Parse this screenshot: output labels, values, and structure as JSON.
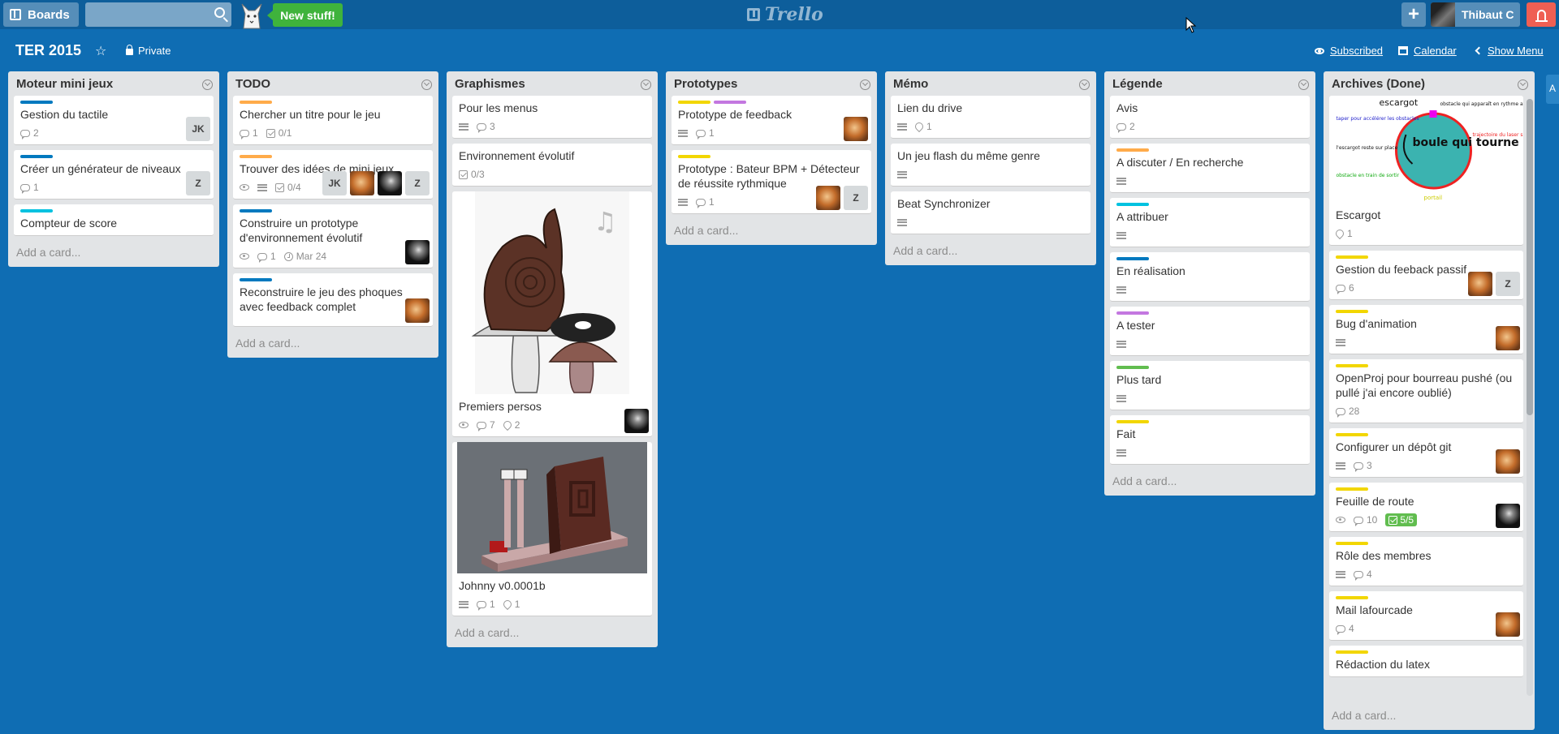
{
  "header": {
    "boards_label": "Boards",
    "search_placeholder": "",
    "new_stuff_label": "New stuff!",
    "logo_text": "Trello",
    "plus_label": "+",
    "user_name": "Thibaut C"
  },
  "board": {
    "title": "TER 2015",
    "privacy": "Private",
    "subscribed_label": "Subscribed",
    "calendar_label": "Calendar",
    "show_menu_label": "Show Menu",
    "side_tab": "A"
  },
  "colors": {
    "board_bg": "#0f6db3",
    "green": "#61bd4f",
    "yellow": "#f2d600",
    "orange": "#ffab4a",
    "purple": "#c377e0",
    "blue": "#0079bf",
    "sky": "#00c2e0",
    "lime": "#51e898"
  },
  "add_card_label": "Add a card...",
  "lists": [
    {
      "title": "Moteur mini jeux",
      "cards": [
        {
          "labels": [
            "blue"
          ],
          "title": "Gestion du tactile",
          "badges": [
            {
              "icon": "comment",
              "text": "2"
            }
          ],
          "members": [
            {
              "initials": "JK"
            }
          ]
        },
        {
          "labels": [
            "blue"
          ],
          "title": "Créer un générateur de niveaux",
          "badges": [
            {
              "icon": "comment",
              "text": "1"
            }
          ],
          "members": [
            {
              "initials": "Z"
            }
          ]
        },
        {
          "labels": [
            "sky"
          ],
          "title": "Compteur de score",
          "badges": [],
          "members": []
        }
      ]
    },
    {
      "title": "TODO",
      "cards": [
        {
          "labels": [
            "orange"
          ],
          "title": "Chercher un titre pour le jeu",
          "badges": [
            {
              "icon": "comment",
              "text": "1"
            },
            {
              "icon": "check",
              "text": "0/1"
            }
          ],
          "members": []
        },
        {
          "labels": [
            "orange"
          ],
          "title": "Trouver des idées de mini jeux",
          "badges": [
            {
              "icon": "eye",
              "text": ""
            },
            {
              "icon": "desc",
              "text": ""
            },
            {
              "icon": "check",
              "text": "0/4"
            }
          ],
          "members": [
            {
              "initials": "JK"
            },
            {
              "initials": "",
              "style": "fox"
            },
            {
              "initials": "",
              "style": "dark"
            },
            {
              "initials": "Z"
            }
          ]
        },
        {
          "labels": [
            "blue"
          ],
          "title": "Construire un prototype d'environnement évolutif",
          "badges": [
            {
              "icon": "eye",
              "text": ""
            },
            {
              "icon": "comment",
              "text": "1"
            },
            {
              "icon": "clock",
              "text": "Mar 24"
            }
          ],
          "members": [
            {
              "initials": "",
              "style": "dark"
            }
          ]
        },
        {
          "labels": [
            "blue"
          ],
          "title": "Reconstruire le jeu des phoques avec feedback complet",
          "badges": [],
          "members": [
            {
              "initials": "",
              "style": "fox"
            }
          ]
        }
      ]
    },
    {
      "title": "Graphismes",
      "cards": [
        {
          "labels": [],
          "title": "Pour les menus",
          "badges": [
            {
              "icon": "desc",
              "text": ""
            },
            {
              "icon": "comment",
              "text": "3"
            }
          ],
          "members": []
        },
        {
          "labels": [],
          "title": "Environnement évolutif",
          "badges": [
            {
              "icon": "check",
              "text": "0/3"
            }
          ],
          "members": []
        },
        {
          "labels": [],
          "cover": "snail",
          "title": "Premiers persos",
          "badges": [
            {
              "icon": "eye",
              "text": ""
            },
            {
              "icon": "comment",
              "text": "7"
            },
            {
              "icon": "attach",
              "text": "2"
            }
          ],
          "members": [
            {
              "initials": "",
              "style": "dark"
            }
          ]
        },
        {
          "labels": [],
          "cover": "render",
          "title": "Johnny v0.0001b",
          "badges": [
            {
              "icon": "desc",
              "text": ""
            },
            {
              "icon": "comment",
              "text": "1"
            },
            {
              "icon": "attach",
              "text": "1"
            }
          ],
          "members": []
        }
      ]
    },
    {
      "title": "Prototypes",
      "cards": [
        {
          "labels": [
            "yellow",
            "purple"
          ],
          "title": "Prototype de feedback",
          "badges": [
            {
              "icon": "desc",
              "text": ""
            },
            {
              "icon": "comment",
              "text": "1"
            }
          ],
          "members": [
            {
              "initials": "",
              "style": "fox"
            }
          ]
        },
        {
          "labels": [
            "yellow"
          ],
          "title": "Prototype : Bateur BPM + Détecteur de réussite rythmique",
          "badges": [
            {
              "icon": "desc",
              "text": ""
            },
            {
              "icon": "comment",
              "text": "1"
            }
          ],
          "members": [
            {
              "initials": "",
              "style": "fox"
            },
            {
              "initials": "Z"
            }
          ]
        }
      ]
    },
    {
      "title": "Mémo",
      "cards": [
        {
          "labels": [],
          "title": "Lien du drive",
          "badges": [
            {
              "icon": "desc",
              "text": ""
            },
            {
              "icon": "attach",
              "text": "1"
            }
          ],
          "members": []
        },
        {
          "labels": [],
          "title": "Un jeu flash du même genre",
          "badges": [
            {
              "icon": "desc",
              "text": ""
            }
          ],
          "members": []
        },
        {
          "labels": [],
          "title": "Beat Synchronizer",
          "badges": [
            {
              "icon": "desc",
              "text": ""
            }
          ],
          "members": []
        }
      ]
    },
    {
      "title": "Légende",
      "cards": [
        {
          "labels": [],
          "title": "Avis",
          "badges": [
            {
              "icon": "comment",
              "text": "2"
            }
          ],
          "members": []
        },
        {
          "labels": [
            "orange"
          ],
          "title": "A discuter / En recherche",
          "badges": [
            {
              "icon": "desc",
              "text": ""
            }
          ],
          "members": []
        },
        {
          "labels": [
            "sky"
          ],
          "title": "A attribuer",
          "badges": [
            {
              "icon": "desc",
              "text": ""
            }
          ],
          "members": []
        },
        {
          "labels": [
            "blue"
          ],
          "title": "En réalisation",
          "badges": [
            {
              "icon": "desc",
              "text": ""
            }
          ],
          "members": []
        },
        {
          "labels": [
            "purple"
          ],
          "title": "A tester",
          "badges": [
            {
              "icon": "desc",
              "text": ""
            }
          ],
          "members": []
        },
        {
          "labels": [
            "green"
          ],
          "title": "Plus tard",
          "badges": [
            {
              "icon": "desc",
              "text": ""
            }
          ],
          "members": []
        },
        {
          "labels": [
            "yellow"
          ],
          "title": "Fait",
          "badges": [
            {
              "icon": "desc",
              "text": ""
            }
          ],
          "members": []
        }
      ]
    },
    {
      "title": "Archives (Done)",
      "cards": [
        {
          "labels": [],
          "cover": "sketch",
          "title": "Escargot",
          "badges": [
            {
              "icon": "attach",
              "text": "1"
            }
          ],
          "members": []
        },
        {
          "labels": [
            "yellow"
          ],
          "title": "Gestion du feeback passif",
          "badges": [
            {
              "icon": "comment",
              "text": "6"
            }
          ],
          "members": [
            {
              "initials": "",
              "style": "fox"
            },
            {
              "initials": "Z"
            }
          ]
        },
        {
          "labels": [
            "yellow"
          ],
          "title": "Bug d'animation",
          "badges": [
            {
              "icon": "desc",
              "text": ""
            }
          ],
          "members": [
            {
              "initials": "",
              "style": "fox"
            }
          ]
        },
        {
          "labels": [
            "yellow"
          ],
          "title": "OpenProj pour bourreau pushé (ou pullé j'ai encore oublié)",
          "badges": [
            {
              "icon": "comment",
              "text": "28"
            }
          ],
          "members": []
        },
        {
          "labels": [
            "yellow"
          ],
          "title": "Configurer un dépôt git",
          "badges": [
            {
              "icon": "desc",
              "text": ""
            },
            {
              "icon": "comment",
              "text": "3"
            }
          ],
          "members": [
            {
              "initials": "",
              "style": "fox"
            }
          ]
        },
        {
          "labels": [
            "yellow"
          ],
          "title": "Feuille de route",
          "badges": [
            {
              "icon": "eye",
              "text": ""
            },
            {
              "icon": "comment",
              "text": "10"
            },
            {
              "icon": "checkdone",
              "text": "5/5"
            }
          ],
          "members": [
            {
              "initials": "",
              "style": "dark"
            }
          ]
        },
        {
          "labels": [
            "yellow"
          ],
          "title": "Rôle des membres",
          "badges": [
            {
              "icon": "desc",
              "text": ""
            },
            {
              "icon": "comment",
              "text": "4"
            }
          ],
          "members": []
        },
        {
          "labels": [
            "yellow"
          ],
          "title": "Mail lafourcade",
          "badges": [
            {
              "icon": "comment",
              "text": "4"
            }
          ],
          "members": [
            {
              "initials": "",
              "style": "fox"
            }
          ]
        },
        {
          "labels": [
            "yellow"
          ],
          "title": "Rédaction du latex",
          "badges": [],
          "members": []
        }
      ]
    }
  ],
  "sketch_text": {
    "title": "escargot",
    "center": "boule qui tourne",
    "left_top": "taper pour accélérer les obstacles",
    "left_mid": "l'escargot reste sur place",
    "left_bottom": "obstacle en train de sortir",
    "right_top": "obstacle qui apparaît en rythme avec la musique",
    "right_mid": "trajectoire du laser si le joueur tire dans le vide",
    "bottom": "portail"
  }
}
